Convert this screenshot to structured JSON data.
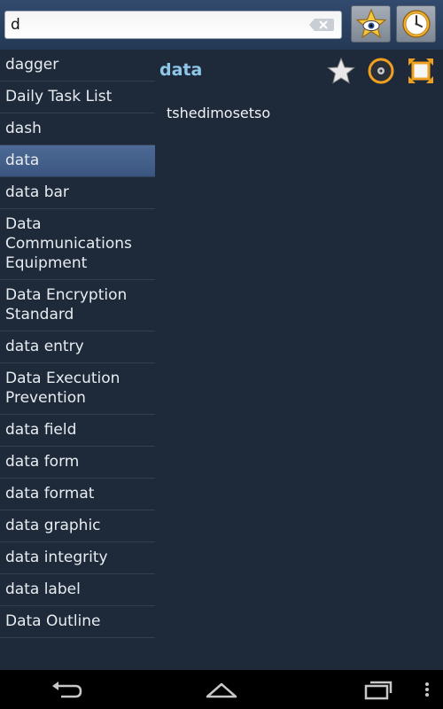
{
  "search": {
    "value": "d",
    "placeholder": ""
  },
  "toolbar": {
    "favorites_icon": "star-eye-icon",
    "history_icon": "clock-icon"
  },
  "word_list": {
    "items": [
      {
        "label": "dagger",
        "selected": false
      },
      {
        "label": "Daily Task List",
        "selected": false
      },
      {
        "label": "dash",
        "selected": false
      },
      {
        "label": "data",
        "selected": true
      },
      {
        "label": "data bar",
        "selected": false
      },
      {
        "label": "Data Communications Equipment",
        "selected": false
      },
      {
        "label": "Data Encryption Standard",
        "selected": false
      },
      {
        "label": "data entry",
        "selected": false
      },
      {
        "label": "Data Execution Prevention",
        "selected": false
      },
      {
        "label": "data field",
        "selected": false
      },
      {
        "label": "data form",
        "selected": false
      },
      {
        "label": "data format",
        "selected": false
      },
      {
        "label": "data graphic",
        "selected": false
      },
      {
        "label": "data integrity",
        "selected": false
      },
      {
        "label": "data label",
        "selected": false
      },
      {
        "label": "Data Outline",
        "selected": false
      }
    ]
  },
  "detail": {
    "title": "data",
    "translation": "tshedimosetso",
    "icons": [
      "star-icon",
      "audio-icon",
      "expand-icon"
    ]
  },
  "colors": {
    "accent_title": "#8ec7e8",
    "selected_row": "#4d6a96",
    "background": "#1e2a3a",
    "icon_orange": "#f0a020"
  }
}
